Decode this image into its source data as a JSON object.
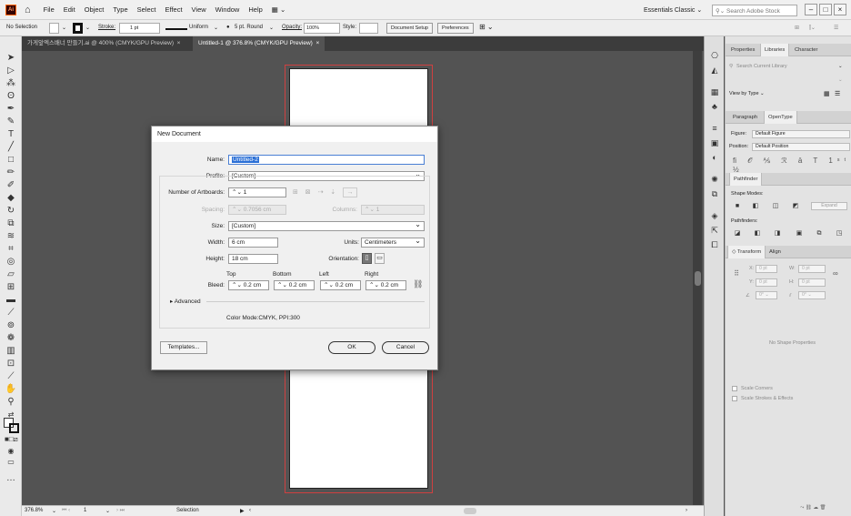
{
  "app": {
    "logo": "Ai",
    "menus": [
      "File",
      "Edit",
      "Object",
      "Type",
      "Select",
      "Effect",
      "View",
      "Window",
      "Help"
    ],
    "workspace": "Essentials Classic",
    "search_placeholder": "Search Adobe Stock"
  },
  "control": {
    "selection": "No Selection",
    "stroke_label": "Stroke:",
    "stroke_value": "1 pt",
    "uniform": "Uniform",
    "brush": "5 pt. Round",
    "opacity_label": "Opacity:",
    "opacity_value": "100%",
    "style_label": "Style:",
    "doc_setup": "Document Setup",
    "prefs": "Preferences"
  },
  "tabs": [
    {
      "label": "가게앞엑스배너 만들기.ai @ 400% (CMYK/GPU Preview)",
      "close": "×"
    },
    {
      "label": "Untitled-1 @ 376.8% (CMYK/GPU Preview)",
      "close": "×"
    }
  ],
  "status": {
    "zoom": "376.8%",
    "page": "1",
    "mode": "Selection"
  },
  "panels": {
    "top_tabs": [
      "Properties",
      "Libraries",
      "Character"
    ],
    "lib_search": "Search Current Library",
    "view_by": "View by Type",
    "para_tabs": [
      "Paragraph",
      "OpenType"
    ],
    "figure_label": "Figure:",
    "figure_value": "Default Figure",
    "position_label": "Position:",
    "position_value": "Default Position",
    "pathfinder": "Pathfinder",
    "shape_modes": "Shape Modes:",
    "expand": "Expand",
    "pathfinders": "Pathfinders:",
    "transform_tabs": [
      "Transform",
      "Align"
    ],
    "x": "X:",
    "y": "Y:",
    "w": "W:",
    "h": "H:",
    "zero_pt": "0 pt",
    "no_shape": "No Shape Properties",
    "scale_corners": "Scale Corners",
    "scale_strokes": "Scale Strokes & Effects"
  },
  "dialog": {
    "title": "New Document",
    "name_label": "Name:",
    "name_value": "Untitled-2",
    "profile_label": "Profile:",
    "profile_value": "[Custom]",
    "artboards_label": "Number of Artboards:",
    "artboards_value": "1",
    "spacing_label": "Spacing:",
    "spacing_value": "0.7056 cm",
    "columns_label": "Columns:",
    "columns_value": "1",
    "size_label": "Size:",
    "size_value": "[Custom]",
    "width_label": "Width:",
    "width_value": "6 cm",
    "units_label": "Units:",
    "units_value": "Centimeters",
    "height_label": "Height:",
    "height_value": "18 cm",
    "orientation_label": "Orientation:",
    "bleed_label": "Bleed:",
    "bleed_cols": [
      "Top",
      "Bottom",
      "Left",
      "Right"
    ],
    "bleed_value": "0.2 cm",
    "advanced": "Advanced",
    "color_mode": "Color Mode:CMYK, PPI:300",
    "templates": "Templates...",
    "ok": "OK",
    "cancel": "Cancel"
  }
}
